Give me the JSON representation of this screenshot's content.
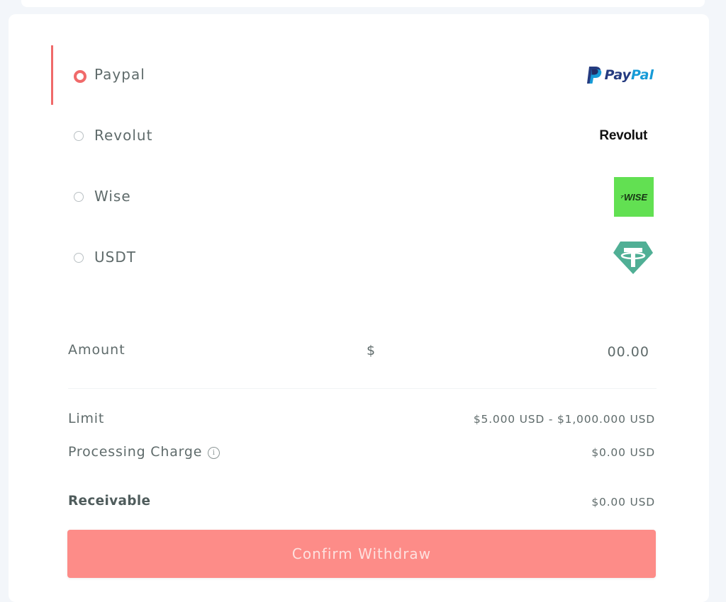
{
  "payment_methods": [
    {
      "label": "Paypal",
      "selected": true,
      "logo": "paypal-logo",
      "logo_text_a": "Pay",
      "logo_text_b": "Pal"
    },
    {
      "label": "Revolut",
      "selected": false,
      "logo": "revolut-logo",
      "logo_text": "Revolut"
    },
    {
      "label": "Wise",
      "selected": false,
      "logo": "wise-logo",
      "logo_text": "⁷WISE"
    },
    {
      "label": "USDT",
      "selected": false,
      "logo": "tether-logo"
    }
  ],
  "amount": {
    "label": "Amount",
    "currency_symbol": "$",
    "placeholder": "00.00"
  },
  "limit": {
    "label": "Limit",
    "value": "$5.000 USD - $1,000.000 USD"
  },
  "processing_charge": {
    "label": "Processing Charge",
    "info_icon": "info-icon",
    "value": "$0.00 USD"
  },
  "receivable": {
    "label": "Receivable",
    "value": "$0.00 USD"
  },
  "confirm_button": {
    "label": "Confirm Withdraw"
  },
  "colors": {
    "accent": "#f06a6a",
    "button": "#fd8c88",
    "text": "#5f6b6b",
    "wise_green": "#62e052",
    "tether_green": "#50af95"
  }
}
